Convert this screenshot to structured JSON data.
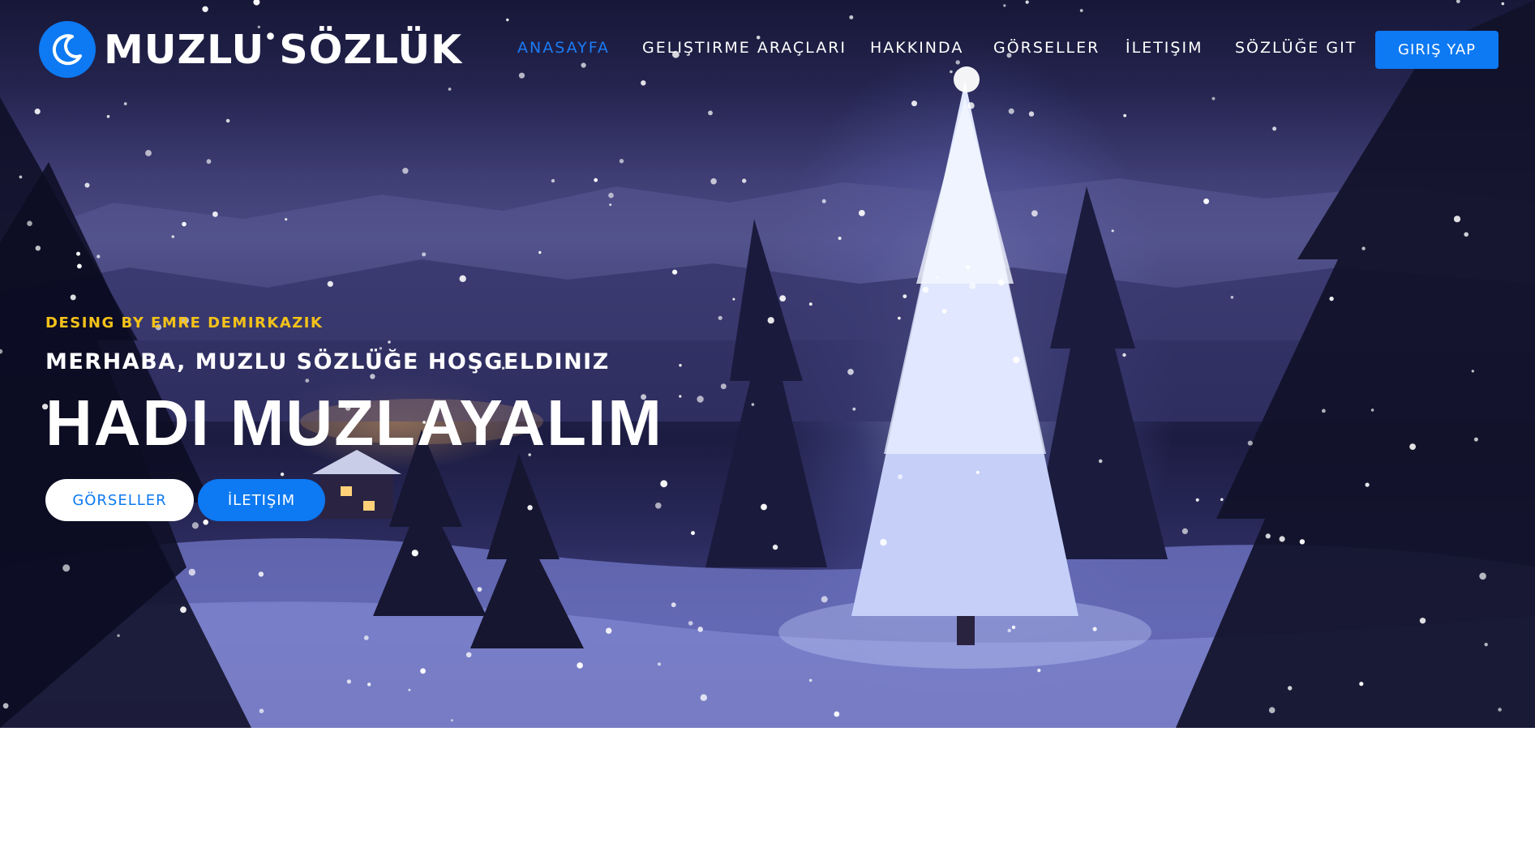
{
  "brand": {
    "name": "MUZLU SÖZLÜK",
    "icon": "moon-icon"
  },
  "nav": {
    "items": [
      {
        "label": "ANASAYFA",
        "active": true
      },
      {
        "label": "GELIŞTIRME ARAÇLARI",
        "active": false
      },
      {
        "label": "HAKKINDA",
        "active": false
      },
      {
        "label": "GÖRSELLER",
        "active": false
      },
      {
        "label": "İLETIŞIM",
        "active": false
      },
      {
        "label": "SÖZLÜĞE GIT",
        "active": false
      }
    ],
    "login_label": "GIRIŞ YAP"
  },
  "hero": {
    "tagline": "DESING BY EMRE DEMIRKAZIK",
    "welcome": "MERHABA, MUZLU SÖZLÜĞE HOŞGELDINIZ",
    "headline": "HADI MUZLAYALIM",
    "primary_button": "GÖRSELLER",
    "secondary_button": "İLETIŞIM"
  },
  "colors": {
    "accent": "#0d79f2",
    "tagline": "#f4c21a",
    "active_nav": "#1b7cf5"
  }
}
